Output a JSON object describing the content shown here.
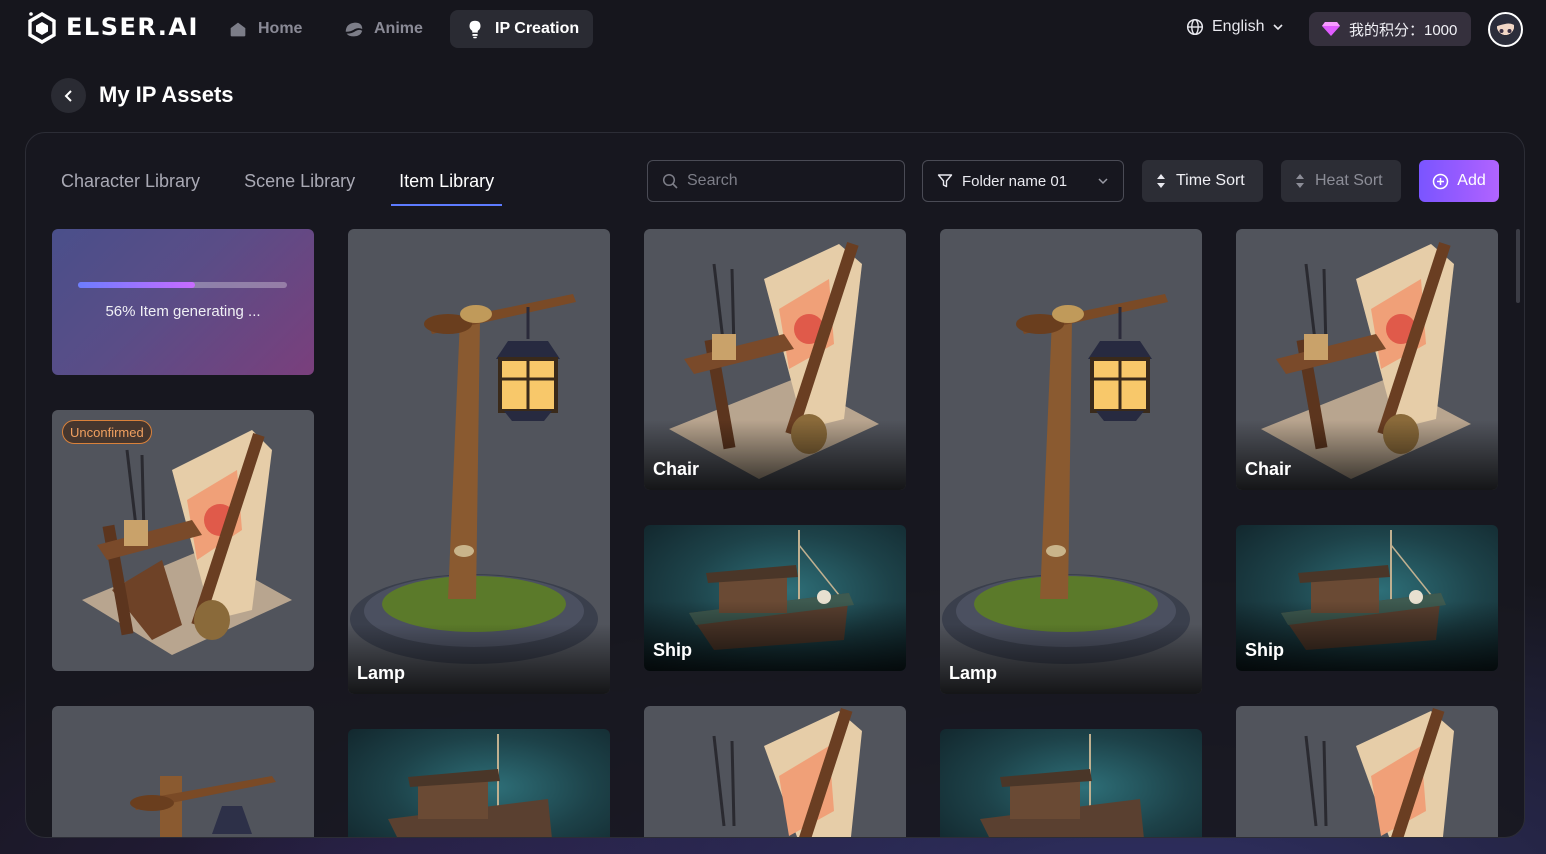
{
  "brand": {
    "name": "ELSER.AI"
  },
  "nav": {
    "items": [
      {
        "label": "Home",
        "icon": "home-icon"
      },
      {
        "label": "Anime",
        "icon": "anime-icon"
      },
      {
        "label": "IP Creation",
        "icon": "bulb-icon"
      }
    ],
    "active": "IP Creation",
    "language": "English",
    "points": "我的积分：1000"
  },
  "page": {
    "title": "My IP Assets"
  },
  "tabs": {
    "items": [
      "Character Library",
      "Scene Library",
      "Item Library"
    ],
    "active": "Item Library"
  },
  "toolbar": {
    "search_placeholder": "Search",
    "folder": "Folder name 01",
    "time_sort": "Time Sort",
    "heat_sort": "Heat Sort",
    "add": "Add"
  },
  "colors": {
    "accent": "#8a5cff",
    "tab_underline": "#5d7bff",
    "badge": "#d9813a"
  },
  "generating": {
    "progress": 0.56,
    "text": "56% Item generating ..."
  },
  "cards": {
    "unconfirmed_badge": "Unconfirmed",
    "c_lamp_1": "Lamp",
    "c_chair_1": "Chair",
    "c_ship_1": "Ship",
    "c_lamp_2": "Lamp",
    "c_chair_2": "Chair",
    "c_ship_2": "Ship"
  }
}
